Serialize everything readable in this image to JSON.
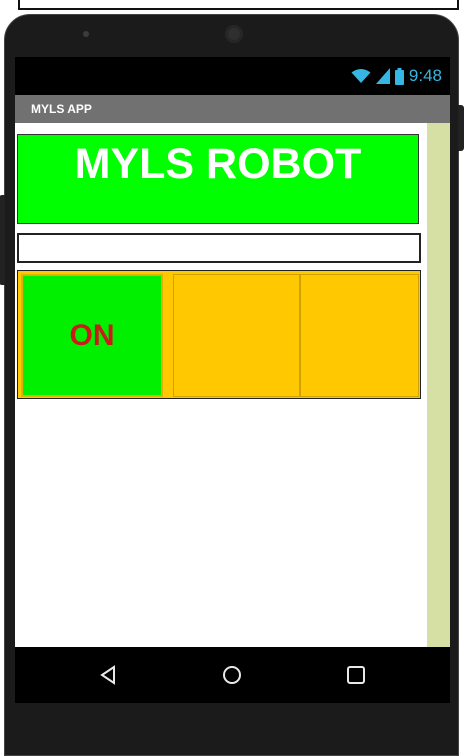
{
  "status_bar": {
    "time": "9:48",
    "icons": [
      "wifi-icon",
      "signal-icon",
      "battery-icon"
    ],
    "icon_color": "#35b6e3"
  },
  "app": {
    "title": "MYLS APP"
  },
  "main": {
    "robot_label": "MYLS ROBOT",
    "robot_label_bg": "#00ff00",
    "text_input_value": "",
    "buttons": [
      {
        "label": "ON",
        "bg": "#00f000",
        "text_color": "#cc1a1a"
      },
      {
        "label": "",
        "bg": "#ffc800"
      },
      {
        "label": "",
        "bg": "#ffc800"
      }
    ]
  },
  "nav": {
    "icons": [
      "back-icon",
      "home-icon",
      "recents-icon"
    ]
  }
}
